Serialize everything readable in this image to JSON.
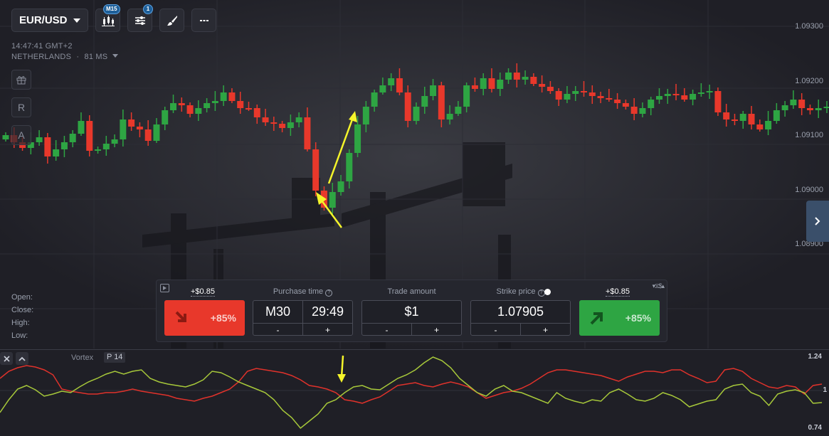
{
  "toolbar": {
    "pair": "EUR/USD",
    "timeframe_badge": "M15",
    "indicators_badge": "1"
  },
  "session": {
    "time": "14:47:41 GMT+2",
    "server": "NETHERLANDS",
    "ping": "81 MS"
  },
  "side_tools": {
    "reset": "R",
    "auto": "A"
  },
  "price_axis": [
    "1.09300",
    "1.09200",
    "1.09100",
    "1.09000",
    "1.08900"
  ],
  "ohlc_labels": {
    "open": "Open:",
    "close": "Close:",
    "high": "High:",
    "low": "Low:"
  },
  "trade_panel": {
    "sell": {
      "payout": "+$0.85",
      "percent": "+85%"
    },
    "buy": {
      "payout": "+$0.85",
      "percent": "+85%"
    },
    "purchase_time": {
      "label": "Purchase time",
      "mode": "M30",
      "value": "29:49"
    },
    "trade_amount": {
      "label": "Trade amount",
      "value": "$1"
    },
    "strike_price": {
      "label": "Strike price",
      "value": "1.07905"
    },
    "minus": "-",
    "plus": "+"
  },
  "indicator": {
    "name": "Vortex",
    "param": "P 14",
    "axis": [
      "1.24",
      "1",
      "0.74"
    ]
  },
  "colors": {
    "bull": "#2ea543",
    "bear": "#e8382b",
    "annotation": "#f5f52a",
    "vi_plus": "#a7c83a",
    "vi_minus": "#e0322b"
  }
}
